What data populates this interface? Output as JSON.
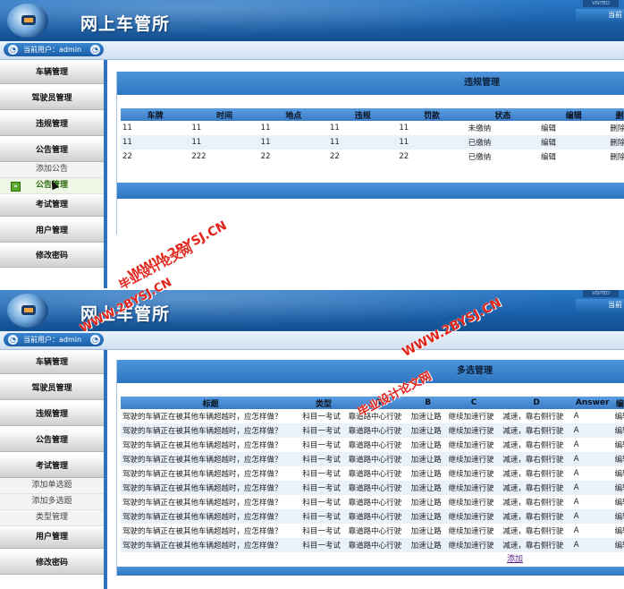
{
  "app": {
    "title": "网上车管所",
    "header_right": "当前",
    "header_badge": "VISITED"
  },
  "user": {
    "label": "当前用户：admin"
  },
  "screen1": {
    "menu": [
      "车辆管理",
      "驾驶员管理",
      "违规管理",
      "公告管理",
      "考试管理",
      "用户管理",
      "修改密码"
    ],
    "submenu": [
      "添加公告",
      "公告管理"
    ],
    "title": "违规管理",
    "columns": [
      "车牌",
      "时间",
      "地点",
      "违规",
      "罚款",
      "状态",
      "编辑",
      "删除"
    ],
    "rows": [
      [
        "11",
        "11",
        "11",
        "11",
        "11",
        "未缴纳",
        "编辑",
        "删除"
      ],
      [
        "11",
        "11",
        "11",
        "11",
        "11",
        "已缴纳",
        "编辑",
        "删除"
      ],
      [
        "22",
        "222",
        "22",
        "22",
        "22",
        "已缴纳",
        "编辑",
        "删除"
      ]
    ]
  },
  "screen2": {
    "menu": [
      "车辆管理",
      "驾驶员管理",
      "违规管理",
      "公告管理",
      "考试管理",
      "用户管理",
      "修改密码"
    ],
    "submenu": [
      "添加单选题",
      "添加多选题",
      "类型管理"
    ],
    "title": "多选管理",
    "columns": [
      "标题",
      "类型",
      "A",
      "B",
      "C",
      "D",
      "Answer",
      "编辑"
    ],
    "row": [
      "驾驶的车辆正在被其他车辆超越时，应怎样做？",
      "科目一考试",
      "靠道路中心行驶",
      "加速让路",
      "继续加速行驶",
      "减速，靠右侧行驶",
      "A",
      "编辑"
    ],
    "row_count": 10,
    "add_link": "添加"
  },
  "watermarks": {
    "site": "WWW.2BYSJ.CN",
    "name": "毕业设计论文网"
  },
  "colors": {
    "header_blue": "#1a5ea8",
    "table_header": "#3a7cc6",
    "watermark_red": "#e32218",
    "row_alt": "#e9f1fb"
  }
}
